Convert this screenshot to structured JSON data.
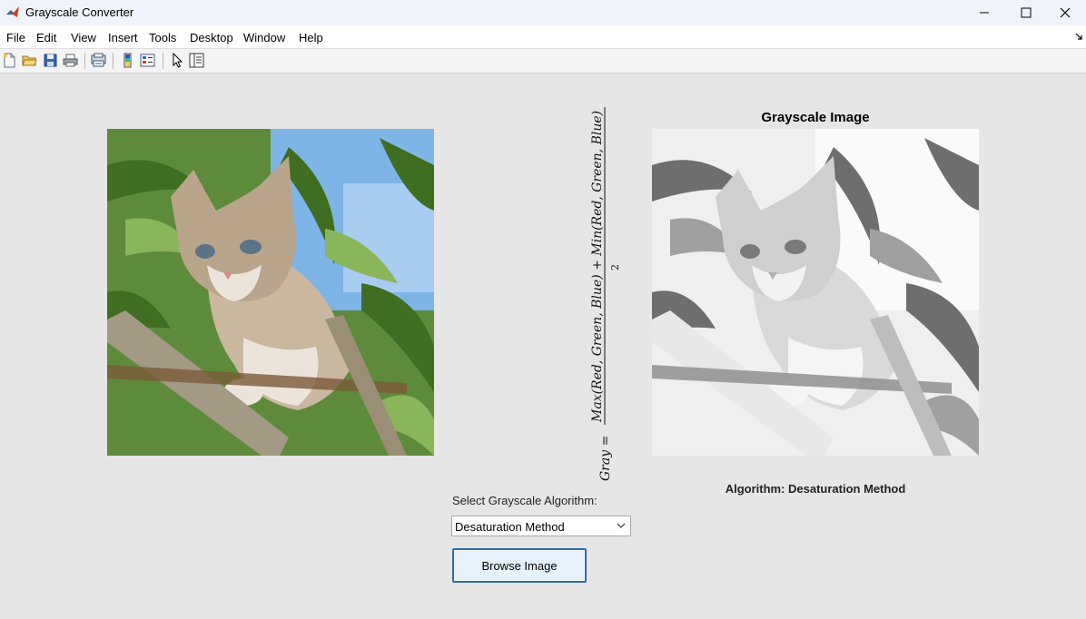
{
  "window": {
    "title": "Grayscale Converter",
    "controls": [
      "minimize-icon",
      "maximize-icon",
      "close-icon"
    ]
  },
  "menu": {
    "items": [
      "File",
      "Edit",
      "View",
      "Insert",
      "Tools",
      "Desktop",
      "Window",
      "Help"
    ]
  },
  "toolbar": {
    "icons": [
      "new-file-icon",
      "open-folder-icon",
      "save-icon",
      "print-icon",
      "print-preview-icon",
      "colorbar-icon",
      "legend-icon",
      "pointer-icon",
      "property-inspector-icon"
    ]
  },
  "axes": {
    "original_title": "",
    "grayscale_title": "Grayscale Image",
    "algorithm_label": "Algorithm: Desaturation Method"
  },
  "formula": {
    "lhs": "Gray =",
    "numerator": "Max(Red, Green, Blue) + Min(Red, Green, Blue)",
    "denominator": "2"
  },
  "controls": {
    "select_label": "Select Grayscale Algorithm:",
    "dropdown_value": "Desaturation Method",
    "browse_label": "Browse Image"
  },
  "colors": {
    "background": "#e6e6e6",
    "button_border": "#2a6ab0",
    "button_fill": "#e5f1fb"
  }
}
